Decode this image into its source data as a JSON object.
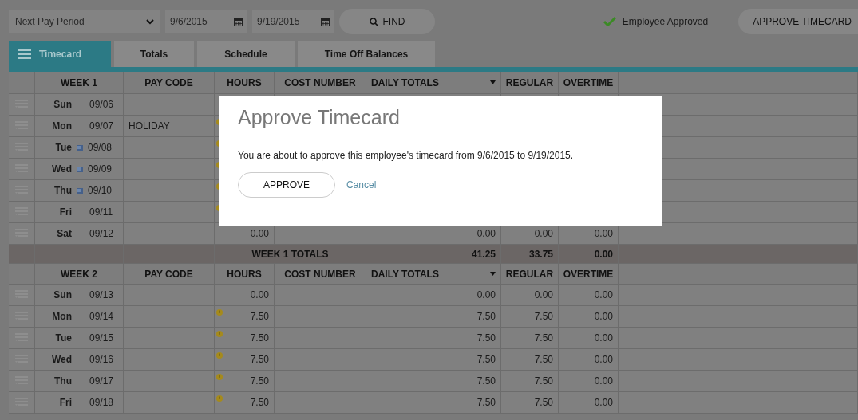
{
  "toolbar": {
    "period": "Next Pay Period",
    "start_date": "9/6/2015",
    "end_date": "9/19/2015",
    "find": "FIND",
    "status": "Employee Approved",
    "approve": "APPROVE TIMECARD"
  },
  "tabs": [
    {
      "label": "Timecard",
      "selected": true
    },
    {
      "label": "Totals",
      "selected": false
    },
    {
      "label": "Schedule",
      "selected": false
    },
    {
      "label": "Time Off Balances",
      "selected": false
    }
  ],
  "weeks": [
    {
      "title": "WEEK 1",
      "columns": [
        "PAY CODE",
        "HOURS",
        "COST NUMBER",
        "DAILY TOTALS",
        "REGULAR",
        "OVERTIME"
      ],
      "rows": [
        {
          "day": "Sun",
          "date": "09/06",
          "note": false,
          "alert": false
        },
        {
          "day": "Mon",
          "date": "09/07",
          "note": false,
          "alert": true,
          "pay_code": "HOLIDAY"
        },
        {
          "day": "Tue",
          "date": "09/08",
          "note": true,
          "alert": true
        },
        {
          "day": "Wed",
          "date": "09/09",
          "note": true,
          "alert": true
        },
        {
          "day": "Thu",
          "date": "09/10",
          "note": true,
          "alert": true
        },
        {
          "day": "Fri",
          "date": "09/11",
          "note": false,
          "alert": true
        },
        {
          "day": "Sat",
          "date": "09/12",
          "note": false,
          "alert": false,
          "hours": "0.00",
          "daily": "0.00",
          "regular": "0.00",
          "overtime": "0.00"
        }
      ],
      "totals": {
        "label": "WEEK 1 TOTALS",
        "daily": "41.25",
        "regular": "33.75",
        "overtime": "0.00"
      }
    },
    {
      "title": "WEEK 2",
      "columns": [
        "PAY CODE",
        "HOURS",
        "COST NUMBER",
        "DAILY TOTALS",
        "REGULAR",
        "OVERTIME"
      ],
      "rows": [
        {
          "day": "Sun",
          "date": "09/13",
          "note": false,
          "alert": false,
          "hours": "0.00",
          "daily": "0.00",
          "regular": "0.00",
          "overtime": "0.00"
        },
        {
          "day": "Mon",
          "date": "09/14",
          "note": false,
          "alert": true,
          "hours": "7.50",
          "daily": "7.50",
          "regular": "7.50",
          "overtime": "0.00"
        },
        {
          "day": "Tue",
          "date": "09/15",
          "note": false,
          "alert": true,
          "hours": "7.50",
          "daily": "7.50",
          "regular": "7.50",
          "overtime": "0.00"
        },
        {
          "day": "Wed",
          "date": "09/16",
          "note": false,
          "alert": true,
          "hours": "7.50",
          "daily": "7.50",
          "regular": "7.50",
          "overtime": "0.00"
        },
        {
          "day": "Thu",
          "date": "09/17",
          "note": false,
          "alert": true,
          "hours": "7.50",
          "daily": "7.50",
          "regular": "7.50",
          "overtime": "0.00"
        },
        {
          "day": "Fri",
          "date": "09/18",
          "note": false,
          "alert": true,
          "hours": "7.50",
          "daily": "7.50",
          "regular": "7.50",
          "overtime": "0.00"
        }
      ]
    }
  ],
  "dialog": {
    "title": "Approve Timecard",
    "message": "You are about to approve this employee's timecard from 9/6/2015 to 9/19/2015.",
    "approve": "APPROVE",
    "cancel": "Cancel"
  }
}
